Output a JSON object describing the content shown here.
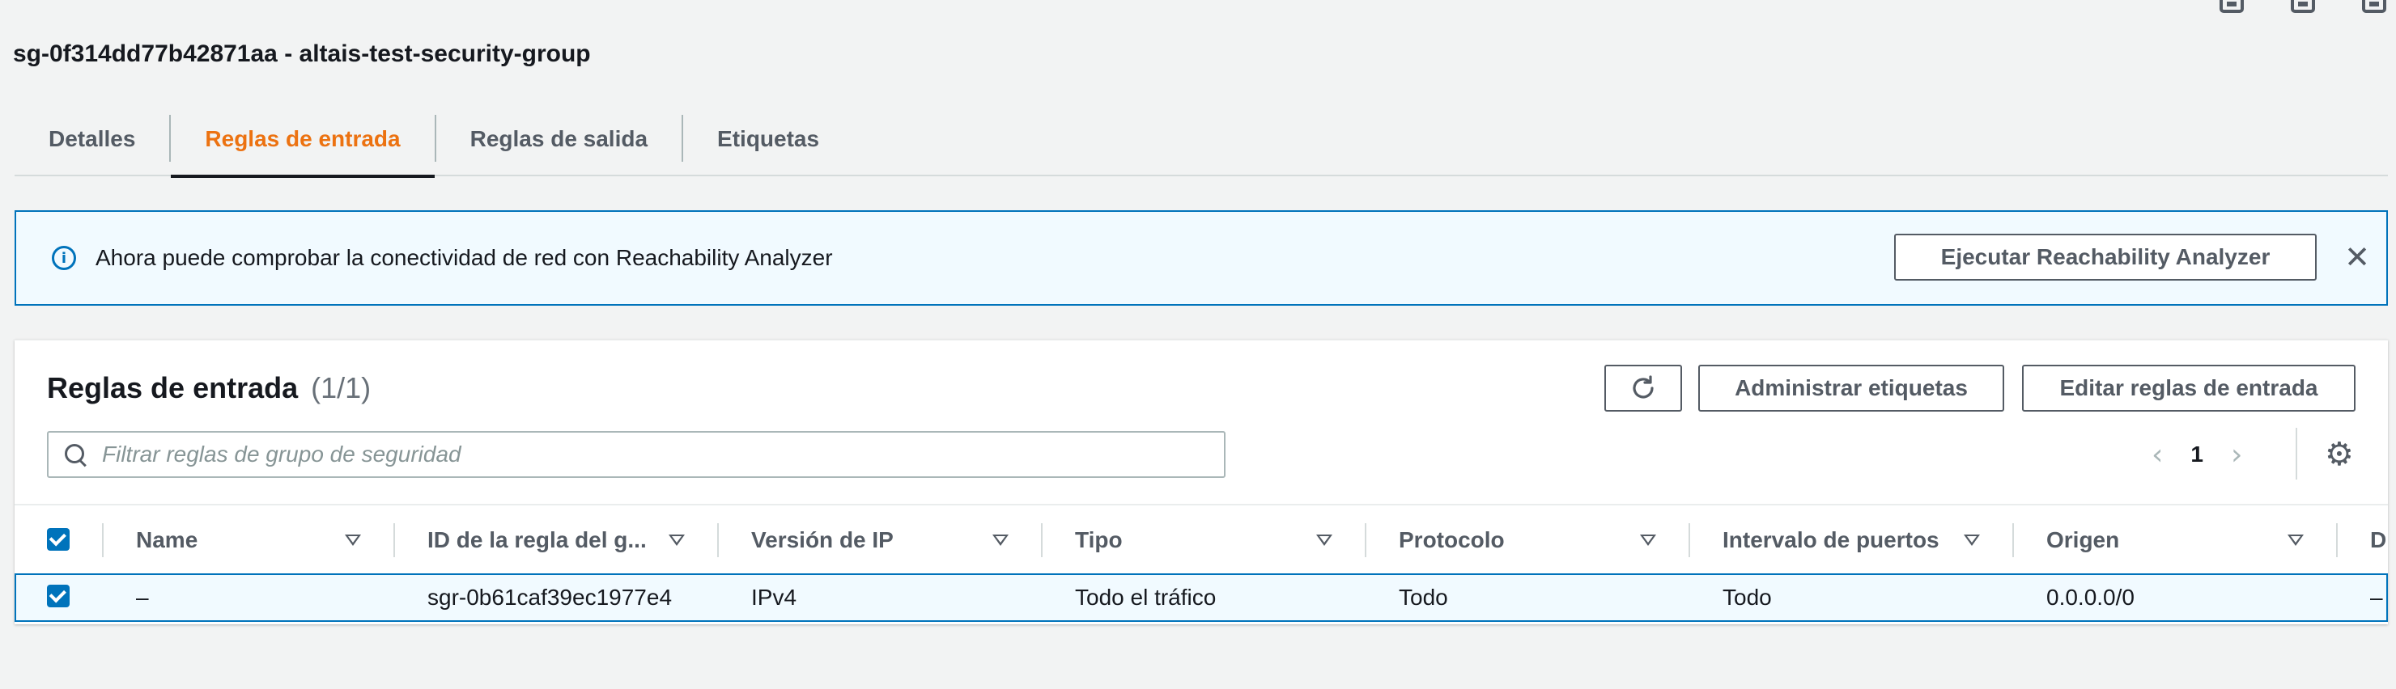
{
  "page": {
    "title": "sg-0f314dd77b42871aa - altais-test-security-group"
  },
  "tabs": [
    {
      "label": "Detalles"
    },
    {
      "label": "Reglas de entrada"
    },
    {
      "label": "Reglas de salida"
    },
    {
      "label": "Etiquetas"
    }
  ],
  "alert": {
    "text": "Ahora puede comprobar la conectividad de red con Reachability Analyzer",
    "button": "Ejecutar Reachability Analyzer"
  },
  "panel": {
    "title": "Reglas de entrada",
    "count": "(1/1)",
    "manage_tags": "Administrar etiquetas",
    "edit_rules": "Editar reglas de entrada",
    "search_placeholder": "Filtrar reglas de grupo de seguridad",
    "page_number": "1"
  },
  "table": {
    "columns": [
      "Name",
      "ID de la regla del g...",
      "Versión de IP",
      "Tipo",
      "Protocolo",
      "Intervalo de puertos",
      "Origen",
      "D"
    ],
    "rows": [
      {
        "name": "–",
        "rule_id": "sgr-0b61caf39ec1977e4",
        "ip_version": "IPv4",
        "type": "Todo el tráfico",
        "protocol": "Todo",
        "port_range": "Todo",
        "source": "0.0.0.0/0",
        "description": "–"
      }
    ]
  },
  "colors": {
    "accent": "#ec7211",
    "primary": "#0073bb"
  }
}
